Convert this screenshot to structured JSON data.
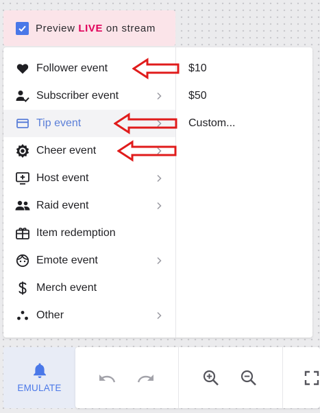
{
  "preview": {
    "label_prefix": "Preview ",
    "label_live": "LIVE",
    "label_suffix": " on stream",
    "checked": true,
    "accent_color": "#4a78e8",
    "live_color": "#e0005a"
  },
  "menu": {
    "items": [
      {
        "label": "Follower event",
        "icon": "heart-icon",
        "has_submenu": false
      },
      {
        "label": "Subscriber event",
        "icon": "person-check-icon",
        "has_submenu": true
      },
      {
        "label": "Tip event",
        "icon": "card-icon",
        "has_submenu": true,
        "active": true
      },
      {
        "label": "Cheer event",
        "icon": "cheer-gear-icon",
        "has_submenu": true
      },
      {
        "label": "Host event",
        "icon": "monitor-plus-icon",
        "has_submenu": true
      },
      {
        "label": "Raid event",
        "icon": "group-icon",
        "has_submenu": true
      },
      {
        "label": "Item redemption",
        "icon": "gift-card-icon",
        "has_submenu": false
      },
      {
        "label": "Emote event",
        "icon": "face-icon",
        "has_submenu": true
      },
      {
        "label": "Merch event",
        "icon": "dollar-icon",
        "has_submenu": false
      },
      {
        "label": "Other",
        "icon": "dots-icon",
        "has_submenu": true
      }
    ],
    "active_color": "#5b7fd8"
  },
  "submenu": {
    "items": [
      "$10",
      "$50",
      "Custom..."
    ]
  },
  "annotations": {
    "arrow_color": "#e01b1b"
  },
  "toolbar": {
    "emulate_label": "EMULATE",
    "buttons": [
      "undo-icon",
      "redo-icon",
      "zoom-in-icon",
      "zoom-out-icon",
      "fullscreen-icon"
    ]
  }
}
